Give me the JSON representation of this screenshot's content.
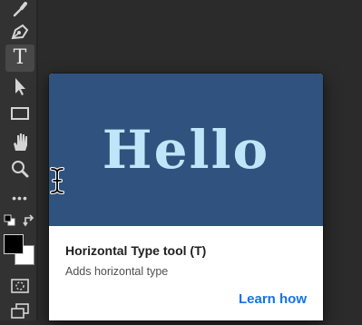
{
  "toolbar": {
    "tools": [
      {
        "icon": "brush-icon"
      },
      {
        "icon": "pen-icon"
      },
      {
        "icon": "type-tool-icon",
        "glyph": "T",
        "active": true
      },
      {
        "icon": "path-selection-icon"
      },
      {
        "icon": "rectangle-icon"
      },
      {
        "icon": "hand-icon"
      },
      {
        "icon": "zoom-icon"
      },
      {
        "icon": "more-tools-icon",
        "glyph": "•••"
      },
      {
        "icon": "default-colors-icon"
      },
      {
        "icon": "swap-colors-icon"
      },
      {
        "icon": "foreground-background-icon"
      },
      {
        "icon": "quick-mask-icon"
      },
      {
        "icon": "screen-mode-icon"
      }
    ],
    "foreground_color": "#000000",
    "background_color": "#ffffff"
  },
  "tooltip": {
    "hero_text": "Hello",
    "hero_background": "#2f527e",
    "hero_text_color": "#bfe6f8",
    "title": "Horizontal Type tool (T)",
    "description": "Adds horizontal type",
    "link_label": "Learn how",
    "link_color": "#1473e6"
  }
}
